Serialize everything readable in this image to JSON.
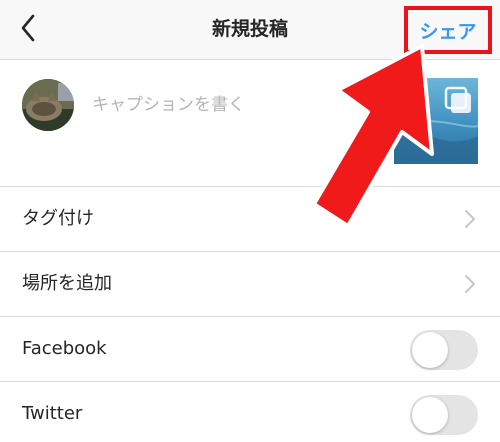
{
  "header": {
    "title": "新規投稿",
    "share_label": "シェア",
    "back_icon": "chevron-left-icon"
  },
  "caption": {
    "placeholder": "キャプションを書く"
  },
  "rows": {
    "tag": {
      "label": "タグ付け"
    },
    "location": {
      "label": "場所を追加"
    },
    "facebook": {
      "label": "Facebook",
      "enabled": false
    },
    "twitter": {
      "label": "Twitter",
      "enabled": false
    }
  },
  "colors": {
    "share_text": "#3897f0",
    "highlight_red": "#e8141b",
    "toggle_off": "#e4e4e4"
  }
}
